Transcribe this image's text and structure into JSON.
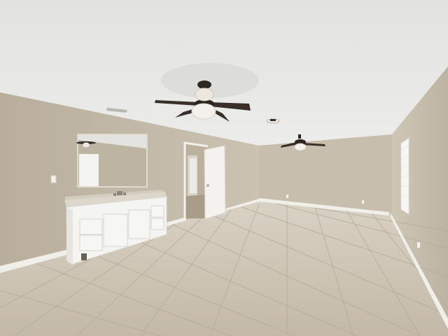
{
  "scene": {
    "description_visible_text": "",
    "colors": {
      "ceiling": "#e6e6e4",
      "wall": "#c9bfae",
      "wall_shadow": "#b7ad9c",
      "floor": "#cfc5b6",
      "grout": "#b3a897",
      "baseboard": "#f2f0ec",
      "vanity": "#f4f4f2",
      "counter": "#d8d2c6",
      "fan_blade": "#3a302a",
      "door": "#f3f2ef",
      "window": "#f7f7f5"
    },
    "objects": [
      "ceiling",
      "left-wall",
      "back-wall",
      "right-wall",
      "tile-floor",
      "ceiling-fan-main",
      "ceiling-fan-rear",
      "ceiling-light",
      "bathroom-vanity",
      "vanity-mirror",
      "interior-door",
      "window-blinds",
      "baseboards"
    ]
  }
}
